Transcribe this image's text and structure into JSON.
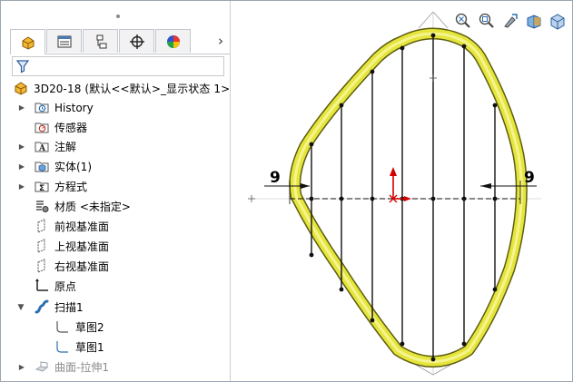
{
  "panel_tabs": [
    {
      "name": "feature-manager-tab",
      "icon": "feature-manager-icon"
    },
    {
      "name": "property-manager-tab",
      "icon": "property-manager-icon"
    },
    {
      "name": "configuration-manager-tab",
      "icon": "configuration-manager-icon"
    },
    {
      "name": "dimxpert-manager-tab",
      "icon": "dimxpert-icon"
    },
    {
      "name": "display-manager-tab",
      "icon": "display-manager-icon"
    }
  ],
  "more_tabs_glyph": "›",
  "tree": {
    "root": "3D20-18  (默认<<默认>_显示状态 1>)",
    "items": {
      "history": "History",
      "sensors": "传感器",
      "annotations": "注解",
      "solid_bodies": "实体(1)",
      "equations": "方程式",
      "material": "材质 <未指定>",
      "front_plane": "前视基准面",
      "top_plane": "上视基准面",
      "right_plane": "右视基准面",
      "origin": "原点",
      "sweep": "扫描1",
      "sketch2": "草图2",
      "sketch1": "草图1",
      "surface_extrude": "曲面-拉伸1"
    }
  },
  "viewport": {
    "dim_left": "9",
    "dim_right": "9",
    "hud_icons": [
      "zoom-to-fit-icon",
      "zoom-to-area-icon",
      "previous-view-icon",
      "section-view-icon",
      "view-orientation-icon"
    ]
  },
  "colors": {
    "sweep_yellow": "#e0e03a",
    "sweep_edge": "#6d6d12",
    "origin_red": "#d40000",
    "tree_icon_blue": "#2a6fb3"
  }
}
